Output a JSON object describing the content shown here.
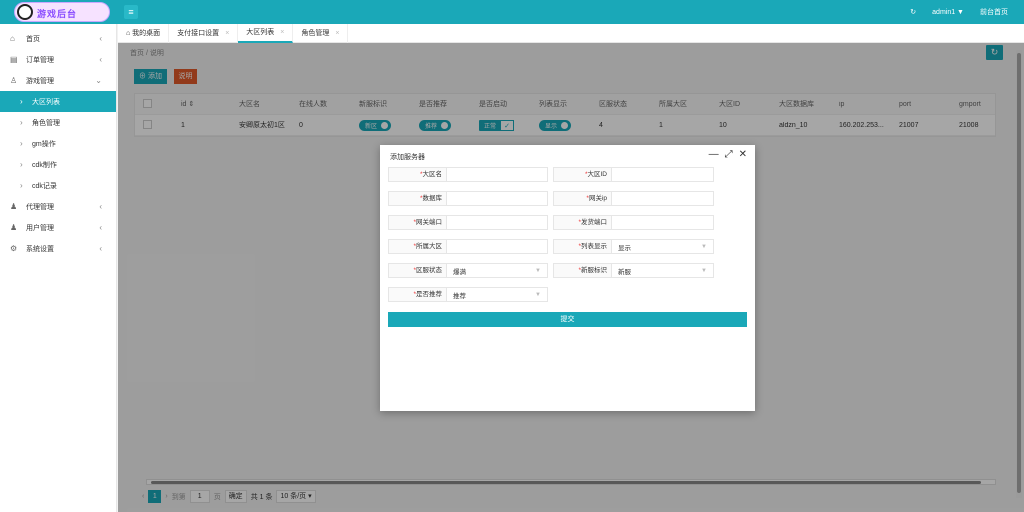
{
  "header": {
    "logo_text": "游戏后台",
    "user": "admin1 ▼",
    "home_link": "前台首页",
    "refresh_icon": "↻"
  },
  "sidebar": {
    "items": [
      {
        "icon": "⌂",
        "label": "首页",
        "arrow": "‹"
      },
      {
        "icon": "▤",
        "label": "订单管理",
        "arrow": "‹"
      },
      {
        "icon": "♙",
        "label": "游戏管理",
        "arrow": "⌄"
      }
    ],
    "sub": [
      {
        "label": "大区列表",
        "active": true
      },
      {
        "label": "角色管理"
      },
      {
        "label": "gm操作"
      },
      {
        "label": "cdk制作"
      },
      {
        "label": "cdk记录"
      }
    ],
    "bottom": [
      {
        "icon": "♟",
        "label": "代理管理",
        "arrow": "‹"
      },
      {
        "icon": "♟",
        "label": "用户管理",
        "arrow": "‹"
      },
      {
        "icon": "⚙",
        "label": "系统设置",
        "arrow": "‹"
      }
    ]
  },
  "tabs": [
    {
      "label": "⌂ 我的桌面",
      "close": ""
    },
    {
      "label": "支付接口设置",
      "close": "×"
    },
    {
      "label": "大区列表",
      "close": "×",
      "active": true
    },
    {
      "label": "角色管理",
      "close": "×"
    }
  ],
  "breadcrumb": "首页 / 说明",
  "toolbar": {
    "add": "⊕ 添加",
    "desc": "说明"
  },
  "table": {
    "columns": [
      "",
      "id ⇕",
      "大区名",
      "在线人数",
      "新服标识",
      "是否推荐",
      "是否启动",
      "列表显示",
      "区服状态",
      "所属大区",
      "大区ID",
      "大区数据库",
      "ip",
      "port",
      "gmport"
    ],
    "rows": [
      [
        "",
        "1",
        "安卿原太初1区",
        "0",
        "新区",
        "推荐",
        "正常",
        "显示",
        "4",
        "1",
        "10",
        "aldzn_10",
        "160.202.253...",
        "21007",
        "21008"
      ]
    ]
  },
  "pager": {
    "prev": "‹",
    "page": "1",
    "next": "›",
    "goto": "到第",
    "input": "1",
    "page_unit": "页",
    "confirm": "确定",
    "total": "共 1 条",
    "size": "10 条/页 ▾"
  },
  "dialog": {
    "title": "添加服务器",
    "controls": [
      "—",
      "⤢",
      "✕"
    ],
    "fields": [
      {
        "label": "大区名",
        "value": ""
      },
      {
        "label": "大区ID",
        "value": ""
      },
      {
        "label": "数据库",
        "value": ""
      },
      {
        "label": "网关ip",
        "value": ""
      },
      {
        "label": "网关端口",
        "value": ""
      },
      {
        "label": "发货端口",
        "value": ""
      },
      {
        "label": "所属大区",
        "value": ""
      },
      {
        "label": "列表显示",
        "value": "显示"
      },
      {
        "label": "区服状态",
        "value": "爆满"
      },
      {
        "label": "新服标识",
        "value": "新服"
      },
      {
        "label": "是否推荐",
        "value": "推荐"
      }
    ],
    "submit": "提交"
  }
}
